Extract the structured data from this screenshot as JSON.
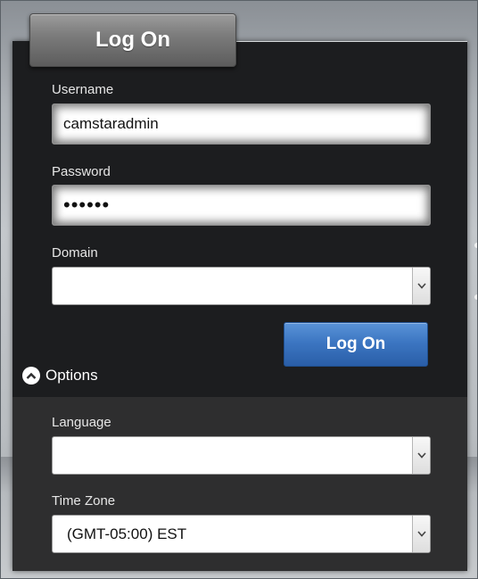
{
  "window": {
    "title": "Log On"
  },
  "form": {
    "username": {
      "label": "Username",
      "value": "camstaradmin"
    },
    "password": {
      "label": "Password",
      "value": "••••••"
    },
    "domain": {
      "label": "Domain",
      "value": ""
    },
    "submit_label": "Log On"
  },
  "options": {
    "toggle_label": "Options",
    "expanded": true,
    "language": {
      "label": "Language",
      "value": ""
    },
    "time_zone": {
      "label": "Time Zone",
      "value": "(GMT-05:00) EST"
    }
  },
  "colors": {
    "panel_background": "#1c1d1f",
    "options_background": "#2e2e2f",
    "button_blue": "#3c76c2"
  },
  "icons": {
    "options_toggle": "chevron-up-circle-icon",
    "select_arrow": "chevron-down-icon"
  }
}
